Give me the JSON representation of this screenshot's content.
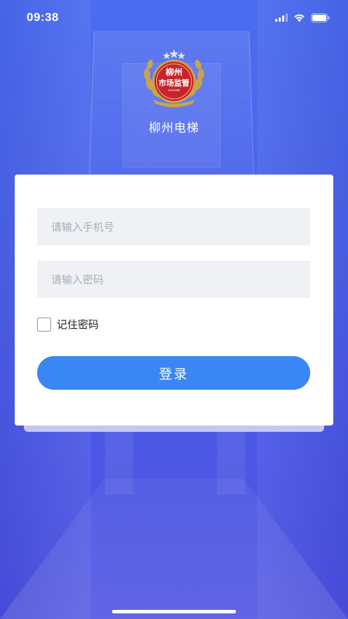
{
  "status_bar": {
    "time": "09:38"
  },
  "header": {
    "logo_text_line1": "柳州",
    "logo_text_line2": "市场监管",
    "logo_subtext": "LZAMR",
    "app_title": "柳州电梯"
  },
  "login_form": {
    "phone_placeholder": "请输入手机号",
    "phone_value": "",
    "password_placeholder": "请输入密码",
    "password_value": "",
    "remember_label": "记住密码",
    "remember_checked": false,
    "submit_label": "登录"
  },
  "colors": {
    "background": "#4b5ee8",
    "primary_button": "#3a86f4",
    "input_background": "#f0f1f5",
    "logo_red": "#c8242b",
    "logo_gold": "#c9a44a"
  },
  "icons": [
    "signal-icon",
    "wifi-icon",
    "battery-icon",
    "logo-emblem"
  ]
}
